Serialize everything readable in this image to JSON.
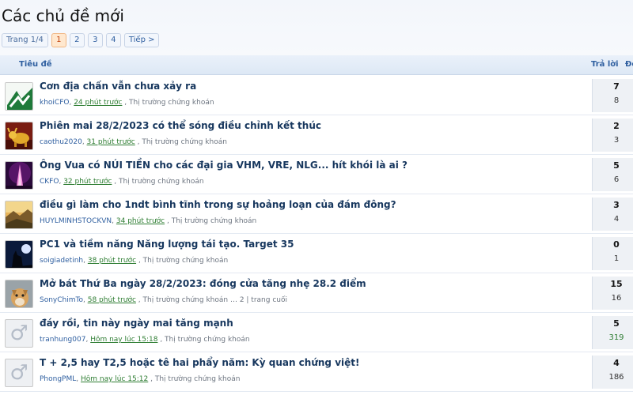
{
  "page_title": "Các chủ đề mới",
  "pagenav": {
    "label": "Trang 1/4",
    "pages": [
      "1",
      "2",
      "3",
      "4"
    ],
    "current": "1",
    "next": "Tiếp >"
  },
  "table_header": {
    "title": "Tiêu đề",
    "replies": "Trả lời",
    "views": "Đọc"
  },
  "colors": {
    "title_link": "#17375e",
    "author_link": "#2f5fa0",
    "time_link": "#2e7d32",
    "current_page": "#ffe8cf"
  },
  "threads": [
    {
      "title": "Cơn địa chấn vẫn chưa xảy ra",
      "author": "khoiCFO",
      "time": "24 phút trước",
      "forum": "Thị trường chứng khoán",
      "extra": "",
      "replies": "7",
      "views": "8",
      "avatar": "green-logo-avatar"
    },
    {
      "title": "Phiên mai 28/2/2023 có thể sóng điều chỉnh kết thúc",
      "author": "caothu2020",
      "time": "31 phút trước",
      "forum": "Thị trường chứng khoán",
      "extra": "",
      "replies": "2",
      "views": "3",
      "avatar": "bull-avatar"
    },
    {
      "title": "Ông Vua có NÚI TIỀN cho các đại gia VHM, VRE, NLG... hít khói là ai ?",
      "author": "CKFO",
      "time": "32 phút trước",
      "forum": "Thị trường chứng khoán",
      "extra": "",
      "replies": "5",
      "views": "6",
      "avatar": "tower-avatar"
    },
    {
      "title": "điều gì làm cho 1ndt bình tĩnh trong sự hoảng loạn của đám đông?",
      "author": "HUYLMINHSTOCKVN",
      "time": "34 phút trước",
      "forum": "Thị trường chứng khoán",
      "extra": "",
      "replies": "3",
      "views": "4",
      "avatar": "landscape-avatar"
    },
    {
      "title": "PC1 và tiềm năng Năng lượng tái tạo. Target 35",
      "author": "soigiadetinh",
      "time": "38 phút trước",
      "forum": "Thị trường chứng khoán",
      "extra": "",
      "replies": "0",
      "views": "1",
      "avatar": "wolf-avatar"
    },
    {
      "title": "Mở bát Thứ Ba ngày 28/2/2023: đóng cửa tăng nhẹ 28.2 điểm",
      "author": "SonyChimTo",
      "time": "58 phút trước",
      "forum": "Thị trường chứng khoán",
      "extra": "…  2  |  trang cuối",
      "replies": "15",
      "views": "16",
      "avatar": "dog-avatar"
    },
    {
      "title": "đáy rồi, tin này ngày mai tăng mạnh",
      "author": "tranhung007",
      "time": "Hôm nay lúc 15:18",
      "forum": "Thị trường chứng khoán",
      "extra": "",
      "replies": "5",
      "views": "319",
      "avatar": "default-male-avatar"
    },
    {
      "title": "T + 2,5 hay T2,5 hoặc tê hai phẩy năm: Kỳ quan chứng việt!",
      "author": "PhongPML",
      "time": "Hôm nay lúc 15:12",
      "forum": "Thị trường chứng khoán",
      "extra": "",
      "replies": "4",
      "views": "186",
      "avatar": "default-male-avatar"
    }
  ]
}
